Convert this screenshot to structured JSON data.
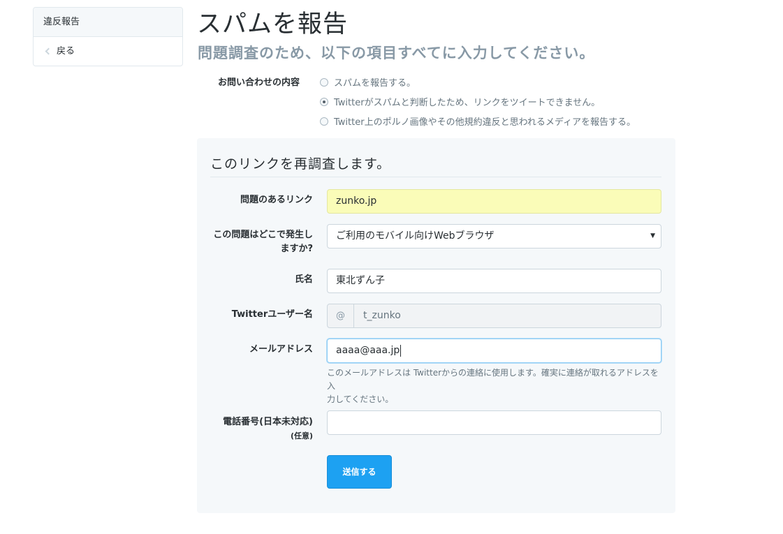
{
  "sidebar": {
    "heading": "違反報告",
    "back_label": "戻る"
  },
  "header": {
    "title": "スパムを報告",
    "subtitle": "問題調査のため、以下の項目すべてに入力してください。"
  },
  "inquiry": {
    "label": "お問い合わせの内容",
    "options": [
      {
        "label": "スパムを報告する。",
        "checked": false
      },
      {
        "label": "Twitterがスパムと判断したため、リンクをツイートできません。",
        "checked": true
      },
      {
        "label": "Twitter上のポルノ画像やその他規約違反と思われるメディアを報告する。",
        "checked": false
      }
    ]
  },
  "form": {
    "title": "このリンクを再調査します。",
    "link_label": "問題のあるリンク",
    "link_value": "zunko.jp",
    "where_label_line1": "この問題はどこで発生し",
    "where_label_line2": "ますか?",
    "where_value": "ご利用のモバイル向けWebブラウザ",
    "name_label": "氏名",
    "name_value": "東北ずん子",
    "username_label": "Twitterユーザー名",
    "username_prefix": "@",
    "username_value": "t_zunko",
    "email_label": "メールアドレス",
    "email_value": "aaaa@aaa.jp",
    "email_help_line1": "このメールアドレスは Twitterからの連絡に使用します。確実に連絡が取れるアドレスを入",
    "email_help_line2": "力してください。",
    "phone_label": "電話番号(日本未対応)",
    "phone_optional": "(任意)",
    "phone_value": "",
    "submit_label": "送信する"
  },
  "colors": {
    "accent": "#1da1f2",
    "highlight_input": "#fafcb8",
    "subtitle": "#8899a6",
    "panel_bg": "#f5f8fa"
  },
  "icons": {
    "back": "chevron-left-icon",
    "select": "caret-down-icon"
  }
}
